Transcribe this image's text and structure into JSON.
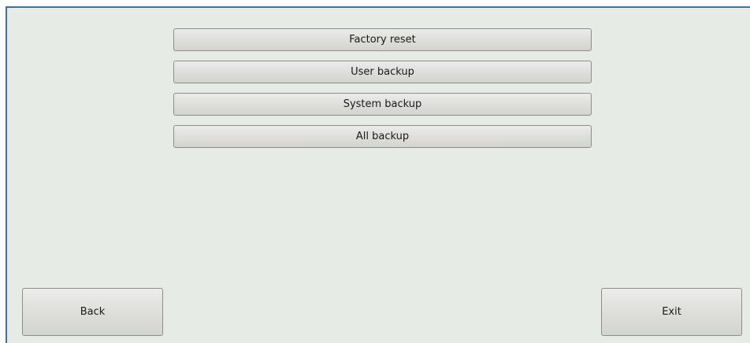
{
  "menu": {
    "items": [
      {
        "label": "Factory reset"
      },
      {
        "label": "User backup"
      },
      {
        "label": "System backup"
      },
      {
        "label": "All backup"
      }
    ]
  },
  "footer": {
    "back_label": "Back",
    "exit_label": "Exit"
  },
  "colors": {
    "window_border": "#3a6fb0",
    "background": "#e7ebe6"
  }
}
